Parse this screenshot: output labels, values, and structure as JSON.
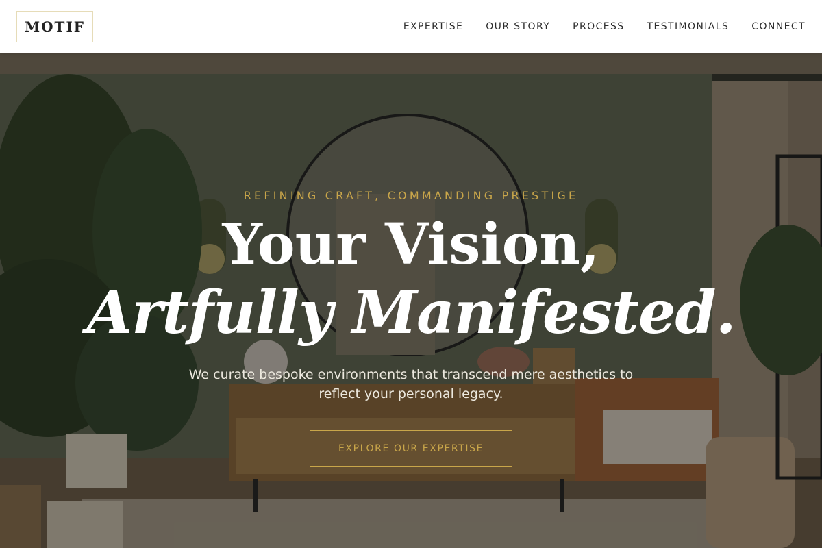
{
  "brand": {
    "logo_text": "MOTIF"
  },
  "nav": {
    "items": [
      {
        "label": "EXPERTISE"
      },
      {
        "label": "OUR STORY"
      },
      {
        "label": "PROCESS"
      },
      {
        "label": "TESTIMONIALS"
      },
      {
        "label": "CONNECT"
      }
    ]
  },
  "hero": {
    "eyebrow": "REFINING CRAFT, COMMANDING PRESTIGE",
    "title_line1": "Your Vision,",
    "title_line2": "Artfully Manifested.",
    "description": "We curate bespoke environments that transcend mere aesthetics to reflect your personal legacy.",
    "cta_label": "EXPLORE OUR EXPERTISE"
  },
  "colors": {
    "accent_gold": "#c9a64a",
    "header_bg": "#ffffff",
    "text_light": "#ffffff"
  }
}
